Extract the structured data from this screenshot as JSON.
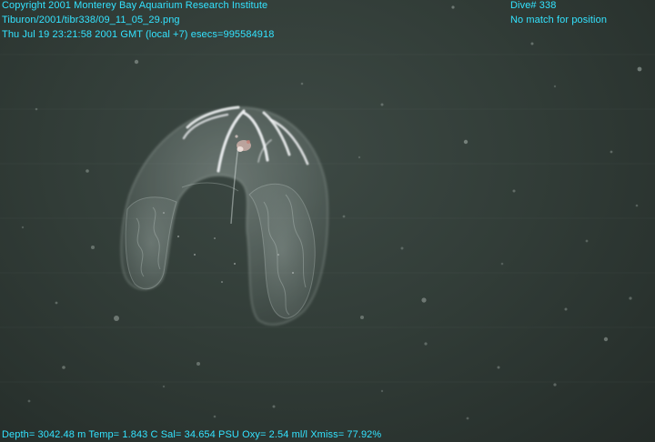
{
  "overlay": {
    "top_left": [
      "Copyright 2001 Monterey Bay Aquarium Research Institute",
      "Tiburon/2001/tibr338/09_11_05_29.png",
      "Thu Jul 19 23:21:58 2001 GMT (local +7)  esecs=995584918"
    ],
    "top_right": [
      "Dive# 338",
      "No match for position"
    ],
    "bottom": "Depth= 3042.48 m  Temp= 1.843 C  Sal= 34.654 PSU  Oxy= 2.54 ml/l  Xmiss= 77.92%"
  },
  "scene": {
    "subject": "translucent comb jelly (ctenophore) drifting in dark deep-sea water with suspended marine snow particles",
    "colors": {
      "water": "#323d38",
      "body": "#c8d4d0",
      "comb_rows": "#f2f4f6",
      "overlay_text": "#33e3ff"
    }
  }
}
